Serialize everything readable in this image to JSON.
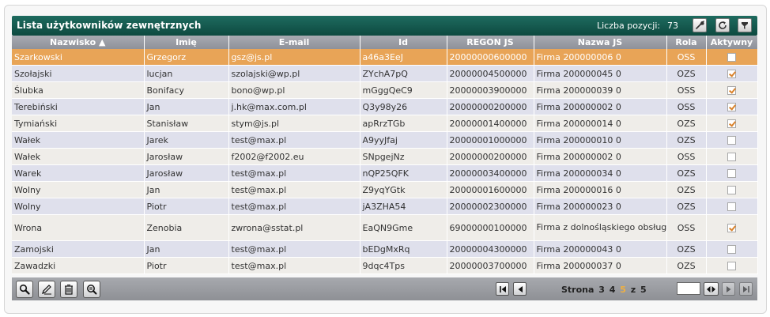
{
  "header": {
    "title": "Lista użytkowników zewnętrznych",
    "count_label": "Liczba pozycji:",
    "count_value": "73",
    "icons": [
      "wrench-icon",
      "refresh-icon",
      "filter-icon"
    ]
  },
  "table": {
    "columns": [
      "Nazwisko ▲",
      "Imię",
      "E-mail",
      "Id",
      "REGON JS",
      "Nazwa JS",
      "Rola",
      "Aktywny"
    ],
    "rows": [
      {
        "nazwisko": "Szarkowski",
        "imie": "Grzegorz",
        "email": "gsz@js.pl",
        "id": "a46a3EeJ",
        "regon": "20000000600000",
        "nazwa": "Firma 200000006 0",
        "rola": "OSS",
        "aktywny": false
      },
      {
        "nazwisko": "Szołajski",
        "imie": "lucjan",
        "email": "szolajski@wp.pl",
        "id": "ZYchA7pQ",
        "regon": "20000004500000",
        "nazwa": "Firma 200000045 0",
        "rola": "OZS",
        "aktywny": true
      },
      {
        "nazwisko": "Ślubka",
        "imie": "Bonifacy",
        "email": "bono@wp.pl",
        "id": "mGggQeC9",
        "regon": "20000003900000",
        "nazwa": "Firma 200000039 0",
        "rola": "OSS",
        "aktywny": true
      },
      {
        "nazwisko": "Terebiński",
        "imie": "Jan",
        "email": "j.hk@max.com.pl",
        "id": "Q3y98y26",
        "regon": "20000000200000",
        "nazwa": "Firma 200000002 0",
        "rola": "OSS",
        "aktywny": true
      },
      {
        "nazwisko": "Tymiański",
        "imie": "Stanisław",
        "email": "stym@js.pl",
        "id": "apRrzTGb",
        "regon": "20000001400000",
        "nazwa": "Firma 200000014 0",
        "rola": "OZS",
        "aktywny": true
      },
      {
        "nazwisko": "Wałek",
        "imie": "Jarek",
        "email": "test@max.pl",
        "id": "A9yyJfaj",
        "regon": "20000001000000",
        "nazwa": "Firma 200000010 0",
        "rola": "OZS",
        "aktywny": false
      },
      {
        "nazwisko": "Wałek",
        "imie": "Jarosław",
        "email": "f2002@f2002.eu",
        "id": "SNpgejNz",
        "regon": "20000000200000",
        "nazwa": "Firma 200000002 0",
        "rola": "OSS",
        "aktywny": false
      },
      {
        "nazwisko": "Warek",
        "imie": "Jarosław",
        "email": "test@max.pl",
        "id": "nQP25QFK",
        "regon": "20000003400000",
        "nazwa": "Firma 200000034 0",
        "rola": "OZS",
        "aktywny": false
      },
      {
        "nazwisko": "Wolny",
        "imie": "Jan",
        "email": "test@max.pl",
        "id": "Z9yqYGtk",
        "regon": "20000001600000",
        "nazwa": "Firma 200000016 0",
        "rola": "OZS",
        "aktywny": false
      },
      {
        "nazwisko": "Wolny",
        "imie": "Piotr",
        "email": "test@max.pl",
        "id": "jA3ZHA54",
        "regon": "20000002300000",
        "nazwa": "Firma 200000023 0",
        "rola": "OZS",
        "aktywny": false
      },
      {
        "nazwisko": "Wrona",
        "imie": "Zenobia",
        "email": "zwrona@sstat.pl",
        "id": "EaQN9Gme",
        "regon": "69000000100000",
        "nazwa": "Firma z dolnośląskiego obsługiwana przez ZG",
        "rola": "OSS",
        "aktywny": true
      },
      {
        "nazwisko": "Zamojski",
        "imie": "Jan",
        "email": "test@max.pl",
        "id": "bEDgMxRq",
        "regon": "20000004300000",
        "nazwa": "Firma 200000043 0",
        "rola": "OZS",
        "aktywny": false
      },
      {
        "nazwisko": "Zawadzki",
        "imie": "Piotr",
        "email": "test@max.pl",
        "id": "9dqc4Tps",
        "regon": "20000003700000",
        "nazwa": "Firma 200000037 0",
        "rola": "OZS",
        "aktywny": false
      }
    ]
  },
  "footer": {
    "tool_icons": [
      "search-icon",
      "edit-icon",
      "delete-icon",
      "search-details-icon"
    ],
    "pager": {
      "label": "Strona",
      "pages": [
        "3",
        "4",
        "5"
      ],
      "current": "5",
      "of": "z",
      "total": "5",
      "page_input_value": ""
    }
  },
  "colors": {
    "title_bar": "#14584d",
    "header_row": "#9a9ca3",
    "selected_row": "#e8a457",
    "odd_row": "#dfe0ec",
    "even_row": "#efede9",
    "current_page": "#f0b040"
  }
}
